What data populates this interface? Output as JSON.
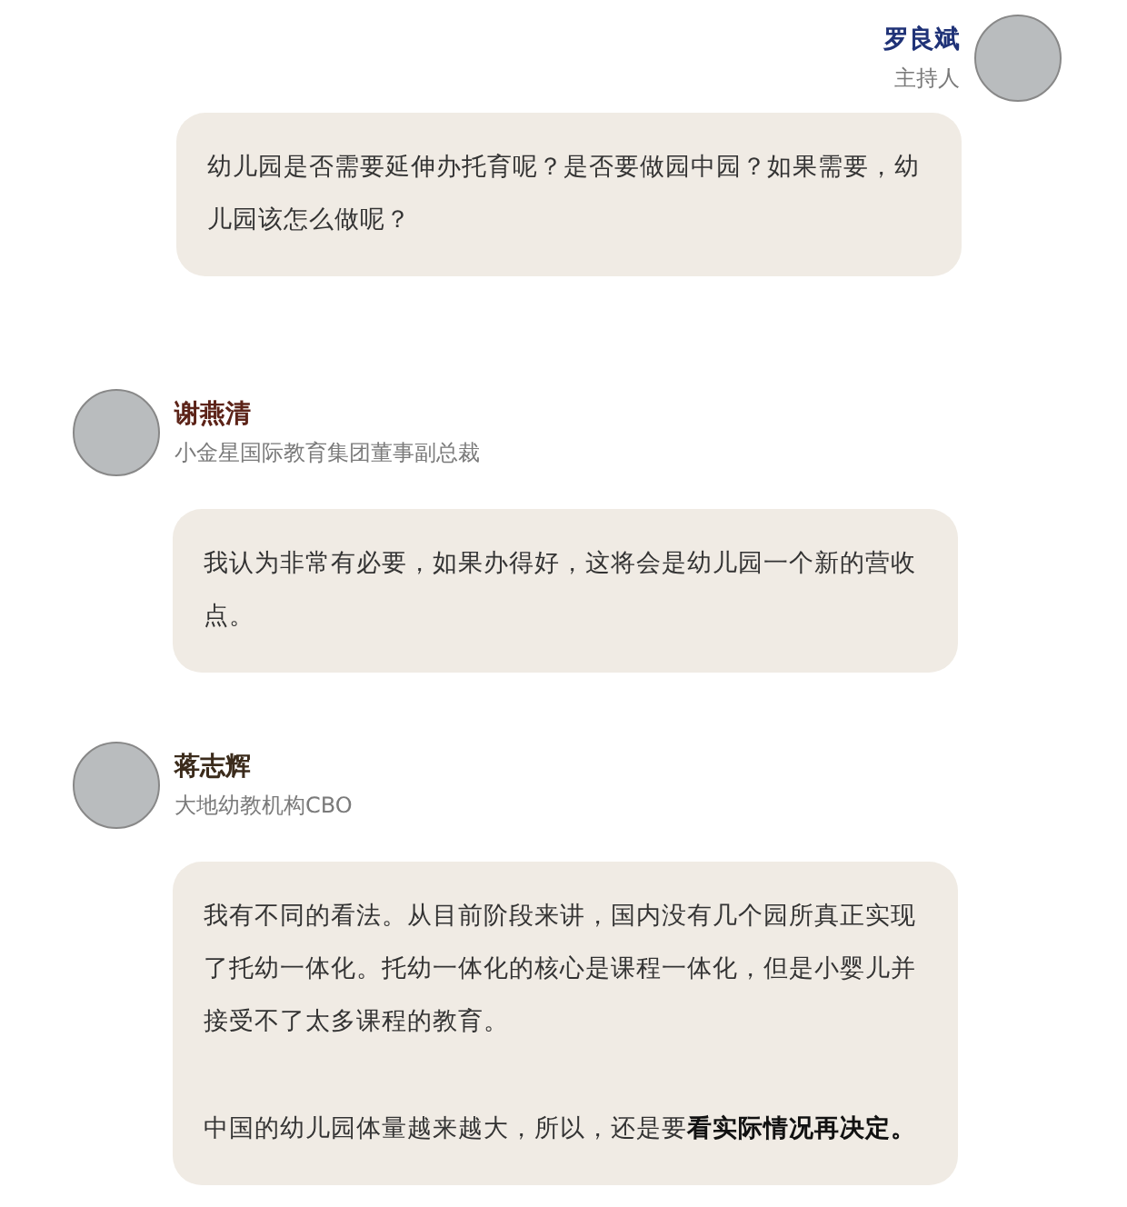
{
  "messages": [
    {
      "kind": "host",
      "name": "罗良斌",
      "role": "主持人",
      "color": "#1f3277",
      "paragraphs": [
        "幼儿园是否需要延伸办托育呢？是否要做园中园？如果需要，幼儿园该怎么做呢？"
      ]
    },
    {
      "kind": "guest",
      "name": "谢燕清",
      "role": "小金星国际教育集团董事副总裁",
      "color": "#5c2318",
      "paragraphs": [
        "我认为非常有必要，如果办得好，这将会是幼儿园一个新的营收点。"
      ]
    },
    {
      "kind": "guest",
      "name": "蒋志辉",
      "role": "大地幼教机构CBO",
      "color": "#3b2b1b",
      "paragraphs": [
        "我有不同的看法。从目前阶段来讲，国内没有几个园所真正实现了托幼一体化。托幼一体化的核心是课程一体化，但是小婴儿并接受不了太多课程的教育。",
        "中国的幼儿园体量越来越大，所以，还是要**看实际情况再决定。**"
      ]
    }
  ]
}
